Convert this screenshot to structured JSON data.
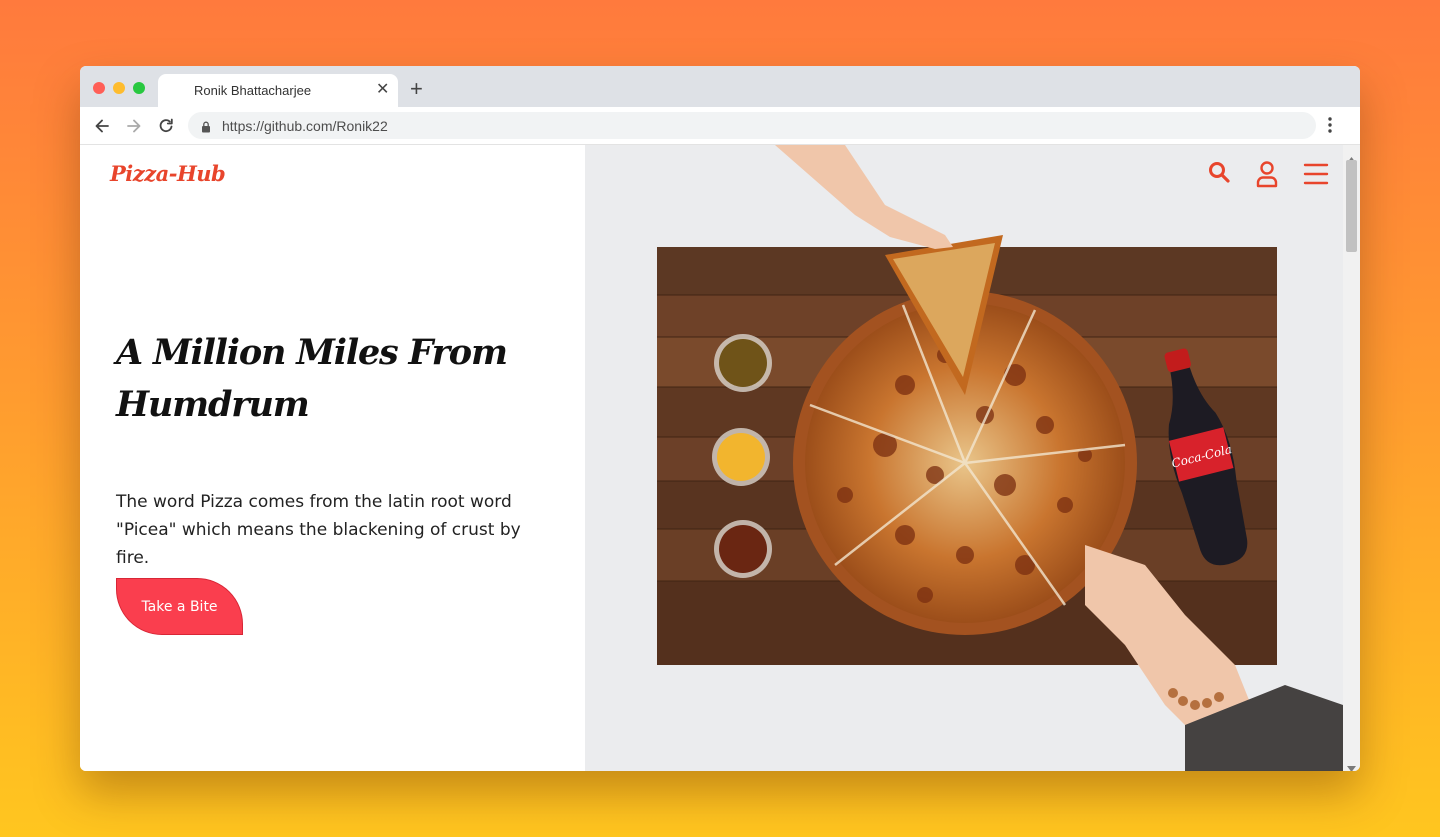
{
  "browser": {
    "tab_title": "Ronik Bhattacharjee",
    "tab_close": "✕",
    "new_tab": "+",
    "url": "https://github.com/Ronik22"
  },
  "page": {
    "logo": "Pizza-Hub",
    "headline": "A Million Miles From Humdrum",
    "description": "The word Pizza comes from the latin root word \"Picea\" which means the blackening of crust by fire.",
    "cta_label": "Take a Bite",
    "bottle_label": "Coca-Cola"
  },
  "colors": {
    "accent": "#e8452c",
    "cta": "#fa3e4e",
    "background_top": "#ff7a3d",
    "background_bottom": "#ffc61f"
  },
  "icons": [
    "search-icon",
    "user-icon",
    "hamburger-menu-icon",
    "back-icon",
    "forward-icon",
    "reload-icon",
    "lock-icon",
    "kebab-menu-icon"
  ]
}
